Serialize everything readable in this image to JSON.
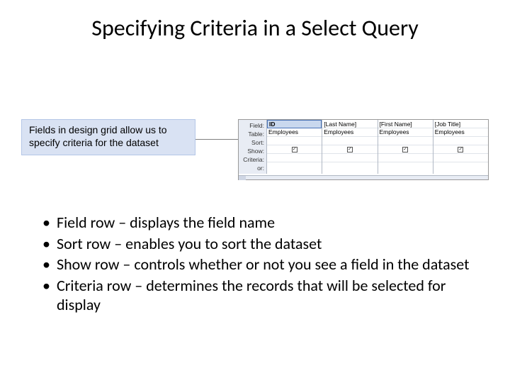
{
  "title": "Specifying Criteria in a Select Query",
  "callout": "Fields in design grid allow us to specify criteria for the dataset",
  "grid": {
    "row_labels": [
      "Field:",
      "Table:",
      "Sort:",
      "Show:",
      "Criteria:",
      "or:"
    ],
    "columns": [
      {
        "field": "ID",
        "table": "Employees",
        "show": true,
        "selected": true
      },
      {
        "field": "[Last Name]",
        "table": "Employees",
        "show": true,
        "selected": false
      },
      {
        "field": "[First Name]",
        "table": "Employees",
        "show": true,
        "selected": false
      },
      {
        "field": "[Job Title]",
        "table": "Employees",
        "show": true,
        "selected": false
      }
    ]
  },
  "bullets": [
    "Field row – displays the field name",
    "Sort row – enables you to sort the dataset",
    "Show row – controls whether or not you see a field in the dataset",
    "Criteria row – determines the records that will be selected for display"
  ]
}
